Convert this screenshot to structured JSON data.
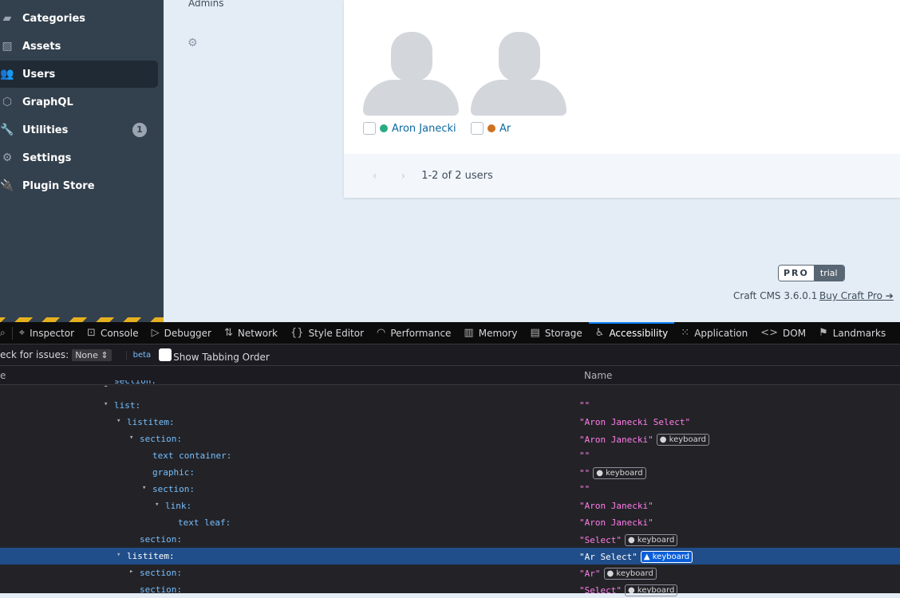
{
  "sidebar": {
    "items": [
      {
        "label": "Categories",
        "icon": "folder-icon",
        "glyph": "▰"
      },
      {
        "label": "Assets",
        "icon": "image-icon",
        "glyph": "▨"
      },
      {
        "label": "Users",
        "icon": "users-icon",
        "glyph": "👥",
        "selected": true
      },
      {
        "label": "GraphQL",
        "icon": "graphql-icon",
        "glyph": "⬡"
      },
      {
        "label": "Utilities",
        "icon": "wrench-icon",
        "glyph": "🔧",
        "badge": "1"
      },
      {
        "label": "Settings",
        "icon": "gear-icon",
        "glyph": "⚙"
      },
      {
        "label": "Plugin Store",
        "icon": "plug-icon",
        "glyph": "🔌"
      }
    ]
  },
  "main": {
    "group": "Admins",
    "users": [
      {
        "name": "Aron Janecki",
        "status_color": "#27ab83"
      },
      {
        "name": "Ar",
        "status_color": "#d0711f"
      }
    ],
    "pagination": {
      "prev": "‹",
      "next": "›",
      "summary": "1-2 of 2 users"
    }
  },
  "footer": {
    "edition": "PRO",
    "trial": "trial",
    "version": "Craft CMS 3.6.0.1",
    "buy": "Buy Craft Pro ➔"
  },
  "devtools": {
    "tabs": [
      {
        "label": "Inspector",
        "glyph": "⌖"
      },
      {
        "label": "Console",
        "glyph": "⊡"
      },
      {
        "label": "Debugger",
        "glyph": "▷"
      },
      {
        "label": "Network",
        "glyph": "⇅"
      },
      {
        "label": "Style Editor",
        "glyph": "{}"
      },
      {
        "label": "Performance",
        "glyph": "◠"
      },
      {
        "label": "Memory",
        "glyph": "▥"
      },
      {
        "label": "Storage",
        "glyph": "▤"
      },
      {
        "label": "Accessibility",
        "glyph": "♿",
        "active": true
      },
      {
        "label": "Application",
        "glyph": "⁙"
      },
      {
        "label": "DOM",
        "glyph": "<>"
      },
      {
        "label": "Landmarks",
        "glyph": "⚑"
      }
    ],
    "toolbar": {
      "check_label": "eck for issues:",
      "check_value": "None ⇕",
      "beta": "beta",
      "tabbing": "Show Tabbing Order"
    },
    "columns": {
      "role": "e",
      "name": "Name"
    },
    "rows": [
      {
        "role": "section:",
        "depth": 0,
        "arrow": "▾",
        "name": ""
      },
      {
        "role": "list:",
        "depth": 0,
        "arrow": "▾",
        "name": "\"\""
      },
      {
        "role": "listitem:",
        "depth": 1,
        "arrow": "▾",
        "name": "\"Aron Janecki Select\""
      },
      {
        "role": "section:",
        "depth": 2,
        "arrow": "▾",
        "name": "\"Aron Janecki\"",
        "badge": "keyboard"
      },
      {
        "role": "text container:",
        "depth": 3,
        "arrow": "",
        "name": "\"\""
      },
      {
        "role": "graphic:",
        "depth": 3,
        "arrow": "",
        "name": "\"\"",
        "badge": "keyboard"
      },
      {
        "role": "section:",
        "depth": 3,
        "arrow": "▾",
        "name": "\"\""
      },
      {
        "role": "link:",
        "depth": 4,
        "arrow": "▾",
        "name": "\"Aron Janecki\""
      },
      {
        "role": "text leaf:",
        "depth": 5,
        "arrow": "",
        "name": "\"Aron Janecki\""
      },
      {
        "role": "section:",
        "depth": 2,
        "arrow": "",
        "name": "\"Select\"",
        "badge": "keyboard"
      },
      {
        "role": "listitem:",
        "depth": 1,
        "arrow": "▾",
        "name": "\"Ar Select\"",
        "badge": "keyboard",
        "warning": true,
        "selected": true
      },
      {
        "role": "section:",
        "depth": 2,
        "arrow": "▸",
        "name": "\"Ar\"",
        "badge": "keyboard"
      },
      {
        "role": "section:",
        "depth": 2,
        "arrow": "",
        "name": "\"Select\"",
        "badge": "keyboard"
      }
    ]
  }
}
